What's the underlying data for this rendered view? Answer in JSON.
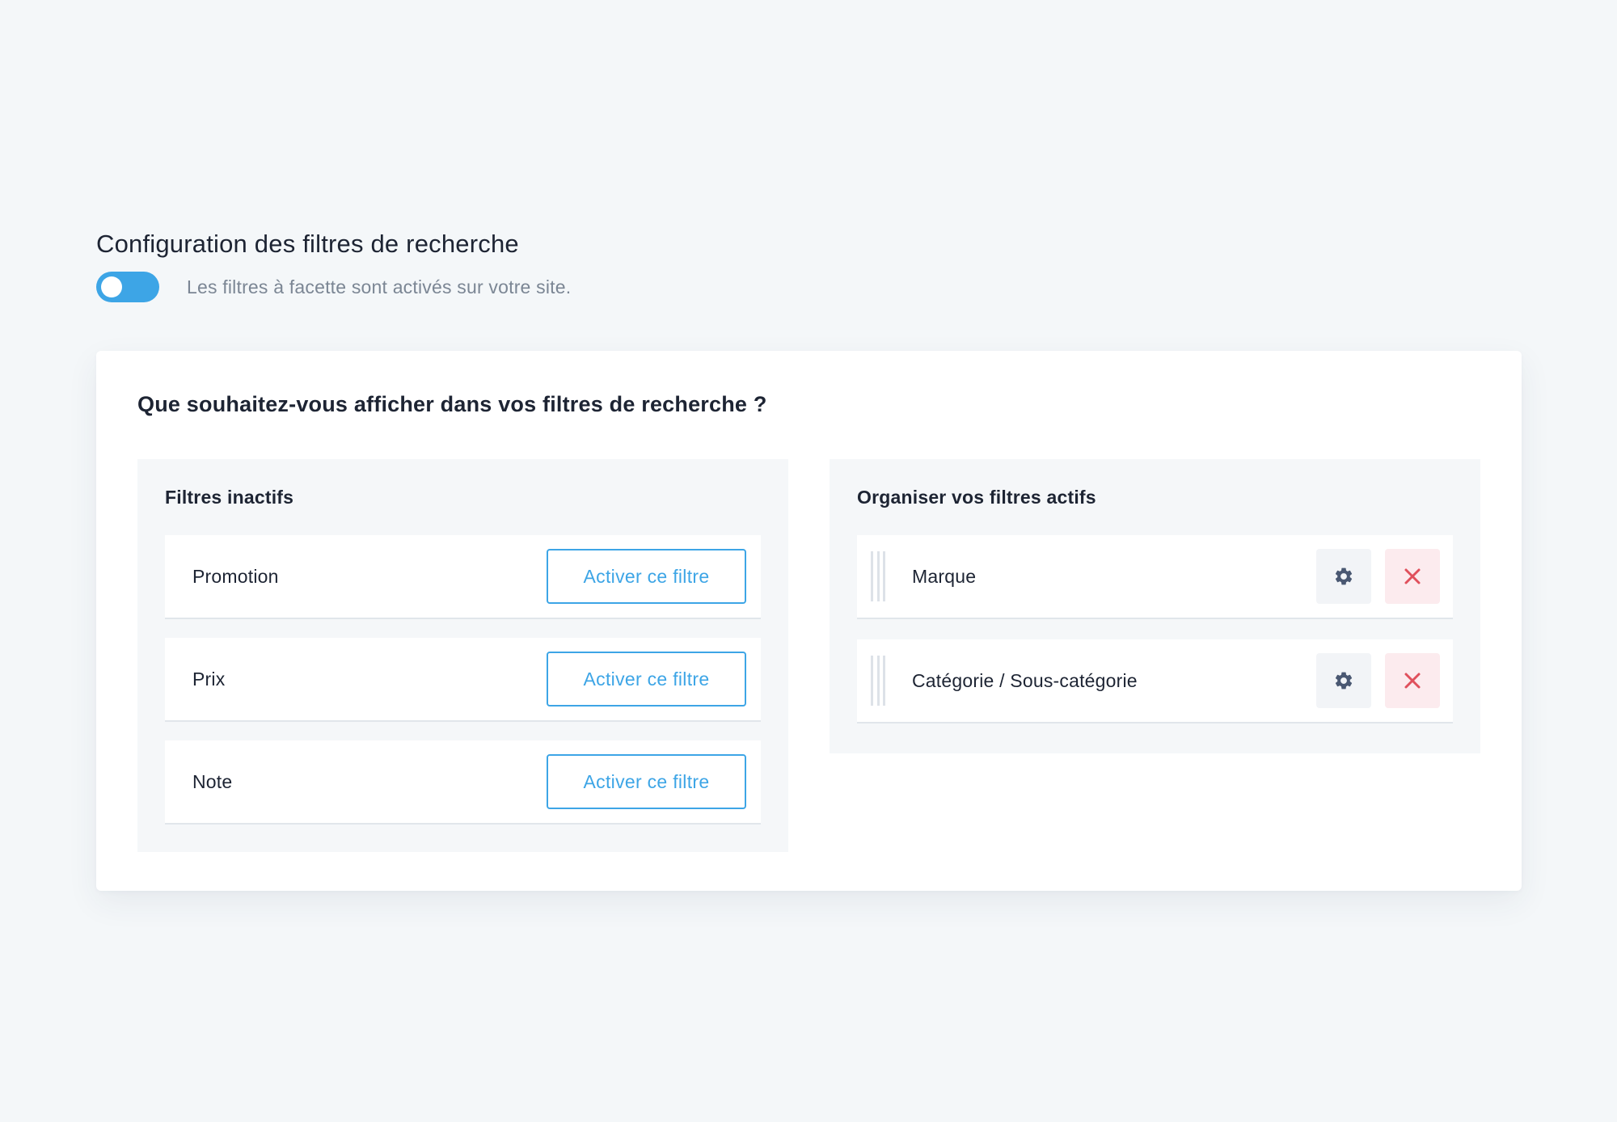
{
  "header": {
    "title": "Configuration des filtres de recherche",
    "toggle_label": "Les filtres à facette sont activés sur votre site.",
    "toggle_on": true
  },
  "card": {
    "title": "Que souhaitez-vous afficher dans vos filtres de recherche ?"
  },
  "inactive": {
    "title": "Filtres inactifs",
    "button_label": "Activer ce filtre",
    "items": [
      {
        "label": "Promotion"
      },
      {
        "label": "Prix"
      },
      {
        "label": "Note"
      }
    ]
  },
  "active": {
    "title": "Organiser vos filtres actifs",
    "items": [
      {
        "label": "Marque"
      },
      {
        "label": "Catégorie / Sous-catégorie"
      }
    ]
  },
  "icons": {
    "settings": "gear-icon",
    "remove": "close-icon",
    "drag": "drag-handle-icon"
  },
  "colors": {
    "accent": "#3da5e6",
    "danger": "#e0505c",
    "danger_bg": "#fcebee",
    "panel_bg": "#f5f7f9",
    "page_bg": "#f4f7f9"
  }
}
